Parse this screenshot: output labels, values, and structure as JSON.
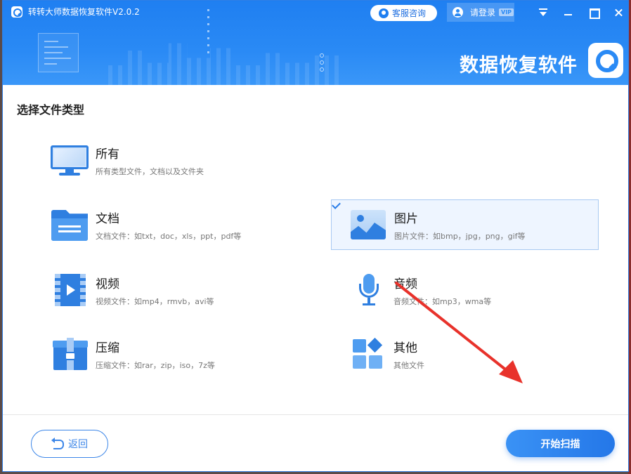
{
  "window": {
    "title": "转转大师数据恢复软件V2.0.2",
    "brand_text": "数据恢复软件"
  },
  "header": {
    "service_label": "客服咨询",
    "login_label": "请登录",
    "vip_badge": "VIP"
  },
  "section_title": "选择文件类型",
  "file_types": [
    {
      "name": "所有",
      "desc": "所有类型文件，文档以及文件夹",
      "icon": "monitor-icon",
      "selected": false
    },
    {
      "name": "文档",
      "desc": "文档文件：如txt，doc，xls，ppt，pdf等",
      "icon": "folder-icon",
      "selected": false
    },
    {
      "name": "图片",
      "desc": "图片文件：如bmp，jpg，png，gif等",
      "icon": "image-icon",
      "selected": true
    },
    {
      "name": "视频",
      "desc": "视频文件：如mp4，rmvb，avi等",
      "icon": "video-icon",
      "selected": false
    },
    {
      "name": "音频",
      "desc": "音频文件：如mp3，wma等",
      "icon": "microphone-icon",
      "selected": false
    },
    {
      "name": "压缩",
      "desc": "压缩文件：如rar，zip，iso，7z等",
      "icon": "archive-icon",
      "selected": false
    },
    {
      "name": "其他",
      "desc": "其他文件",
      "icon": "grid-icon",
      "selected": false
    }
  ],
  "footer": {
    "back_label": "返回",
    "scan_label": "开始扫描"
  },
  "colors": {
    "accent": "#2a8af5",
    "annotation": "#e8322b"
  }
}
